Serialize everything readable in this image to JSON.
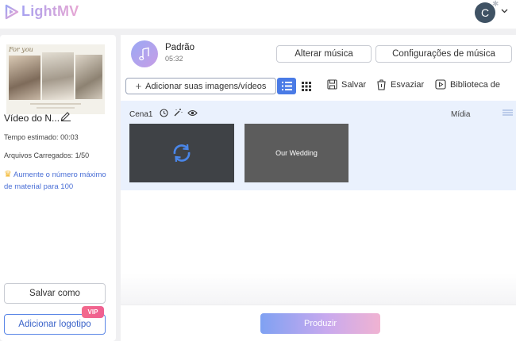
{
  "app": {
    "logo_text": "LightMV"
  },
  "user": {
    "avatar_initial": "C"
  },
  "project": {
    "thumbnail_title": "For you",
    "name": "Vídeo do N...",
    "estimated_time_label": "Tempo estimado:",
    "estimated_time": "00:03",
    "uploaded_files_label": "Arquivos Carregados:",
    "uploaded_files": "1/50",
    "upgrade_text": "Aumente o número máximo de material para 100",
    "save_as_label": "Salvar como",
    "add_logo_label": "Adicionar logotipo",
    "vip_badge": "VIP"
  },
  "music": {
    "title": "Padrão",
    "duration": "05:32",
    "change_label": "Alterar música",
    "settings_label": "Configurações de música"
  },
  "toolbar": {
    "add_media_label": "Adicionar suas imagens/vídeos",
    "save_label": "Salvar",
    "clear_label": "Esvaziar",
    "library_label": "Biblioteca de"
  },
  "scene": {
    "label": "Cena1",
    "media_label": "Mídia",
    "clip_text": "Our Wedding"
  },
  "footer": {
    "produce_label": "Produzir"
  },
  "colors": {
    "accent": "#4a7be6",
    "scene_bg": "#eaf1fd",
    "vip": "#ef5f91",
    "avatar": "#3f5264"
  }
}
